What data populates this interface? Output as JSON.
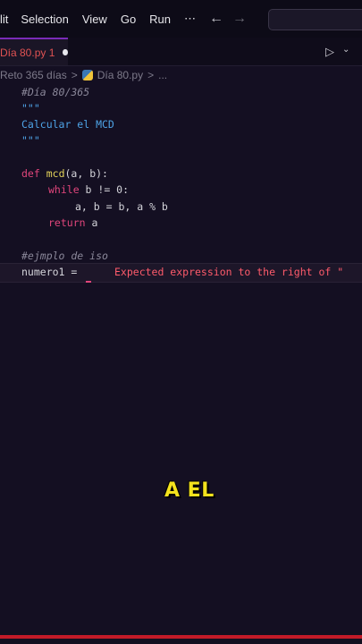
{
  "menubar": {
    "items": [
      "lit",
      "Selection",
      "View",
      "Go",
      "Run",
      "⋯"
    ],
    "back_arrow": "←",
    "forward_arrow": "→"
  },
  "tab": {
    "label": "Día 80.py 1"
  },
  "breadcrumb": {
    "items": [
      "Reto 365 días",
      "Día 80.py",
      "..."
    ],
    "separator": ">"
  },
  "code": {
    "line1": "#Día 80/365",
    "line2": "\"\"\"",
    "line3": "Calcular el MCD",
    "line4": "\"\"\"",
    "line6_kw": "def",
    "line6_fn": "mcd",
    "line6_rest": "(a, b):",
    "line7_kw": "while",
    "line7_rest": " b != 0:",
    "line8": "a, b = b, a % b",
    "line9_kw": "return",
    "line9_rest": " a",
    "line11": "#ejmplo de iso",
    "line12": "numero1 ="
  },
  "error": {
    "message": "Expected expression to the right of \""
  },
  "caption": {
    "text": "A EL"
  },
  "colors": {
    "keyword": "#e0457b",
    "function": "#e3d25a",
    "string": "#4ea3e6",
    "error": "#ff5b6b",
    "accent": "#7a2bb8"
  }
}
